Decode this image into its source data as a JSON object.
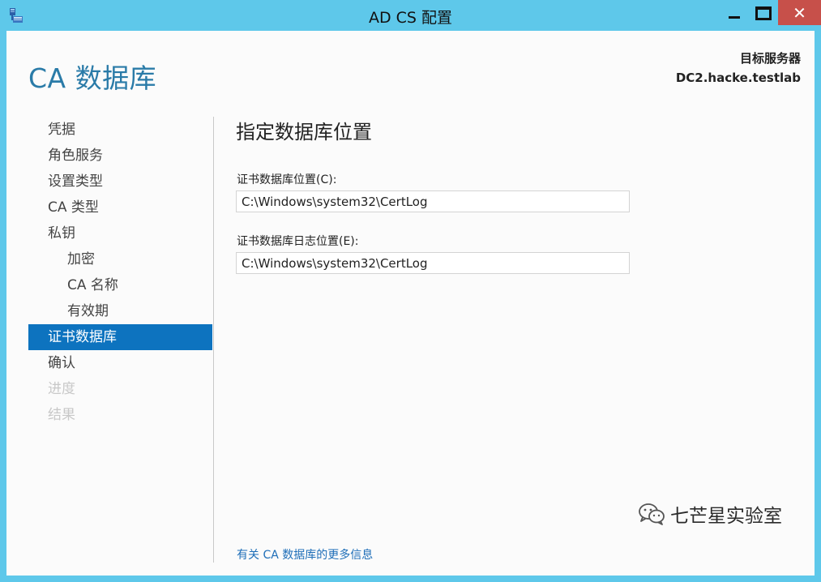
{
  "window": {
    "title": "AD CS 配置",
    "minimize_glyph": "",
    "close_glyph": "✕"
  },
  "header": {
    "page_title": "CA 数据库",
    "target_label": "目标服务器",
    "target_server": "DC2.hacke.testlab"
  },
  "nav": {
    "items": [
      {
        "label": "凭据",
        "state": "normal"
      },
      {
        "label": "角色服务",
        "state": "normal"
      },
      {
        "label": "设置类型",
        "state": "normal"
      },
      {
        "label": "CA 类型",
        "state": "normal"
      },
      {
        "label": "私钥",
        "state": "normal"
      },
      {
        "label": "加密",
        "state": "sub"
      },
      {
        "label": "CA 名称",
        "state": "sub"
      },
      {
        "label": "有效期",
        "state": "sub"
      },
      {
        "label": "证书数据库",
        "state": "active"
      },
      {
        "label": "确认",
        "state": "normal"
      },
      {
        "label": "进度",
        "state": "disabled"
      },
      {
        "label": "结果",
        "state": "disabled"
      }
    ]
  },
  "main": {
    "section_title": "指定数据库位置",
    "db_location_label": "证书数据库位置(C):",
    "db_location_value": "C:\\Windows\\system32\\CertLog",
    "log_location_label": "证书数据库日志位置(E):",
    "log_location_value": "C:\\Windows\\system32\\CertLog",
    "more_info_link": "有关 CA 数据库的更多信息"
  },
  "watermark": {
    "text": "七芒星实验室"
  },
  "colors": {
    "titlebar": "#5ec8ea",
    "accent": "#0d73bf",
    "page_title": "#2a7ba8",
    "close_button": "#c7504a"
  }
}
